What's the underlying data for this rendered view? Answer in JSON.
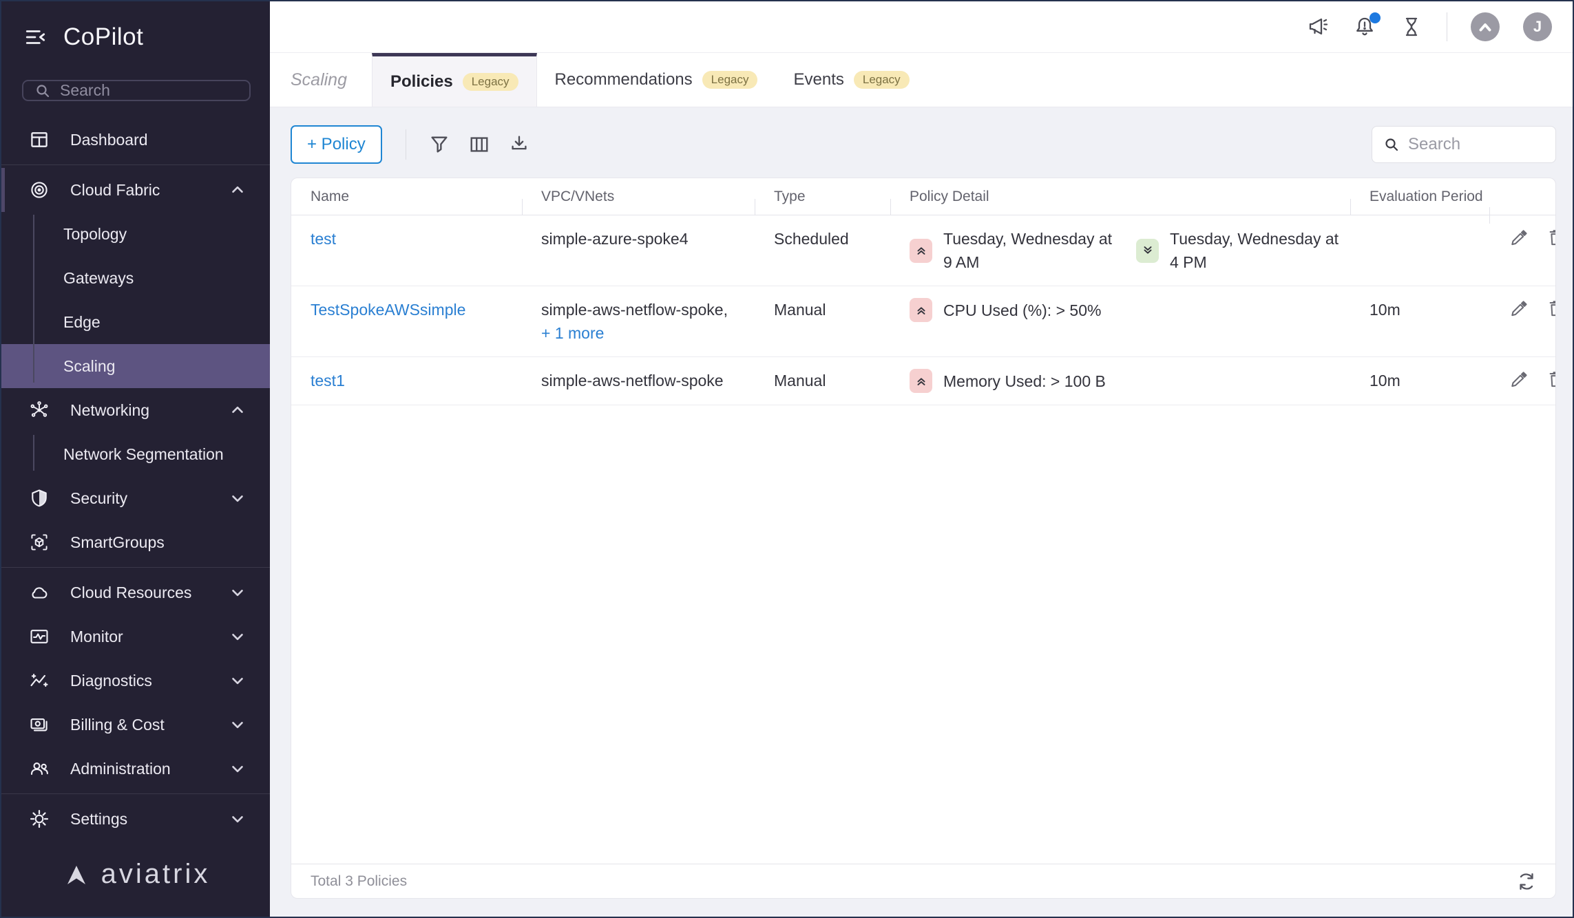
{
  "colors": {
    "sidebar_bg": "#242133",
    "sidebar_selected": "#5d5481",
    "link_blue": "#2a7fd2",
    "primary_blue": "#1f86d3",
    "active_tab_indicator": "#3d3756",
    "legacy_badge_bg": "#f8e9b6",
    "scale_out_badge_bg": "#f6d0d0",
    "scale_in_badge_bg": "#dcecd2",
    "notification_dot": "#1d79e0"
  },
  "sidebar": {
    "brand": "CoPilot",
    "search_placeholder": "Search",
    "items": {
      "dashboard": "Dashboard",
      "cloud_fabric": "Cloud Fabric",
      "topology": "Topology",
      "gateways": "Gateways",
      "edge": "Edge",
      "scaling": "Scaling",
      "networking": "Networking",
      "network_segmentation": "Network Segmentation",
      "security": "Security",
      "smartgroups": "SmartGroups",
      "cloud_resources": "Cloud Resources",
      "monitor": "Monitor",
      "diagnostics": "Diagnostics",
      "billing": "Billing & Cost",
      "administration": "Administration",
      "settings": "Settings"
    },
    "logo_text": "aviatrix"
  },
  "topbar": {
    "icons": [
      "announcements-icon",
      "notifications-icon",
      "tasks-icon"
    ],
    "user_initial": "J"
  },
  "tabs": {
    "page_title": "Scaling",
    "items": [
      {
        "label": "Policies",
        "badge": "Legacy"
      },
      {
        "label": "Recommendations",
        "badge": "Legacy"
      },
      {
        "label": "Events",
        "badge": "Legacy"
      }
    ]
  },
  "toolbar": {
    "add_policy_label": "+ Policy",
    "search_placeholder": "Search"
  },
  "table": {
    "columns": [
      "Name",
      "VPC/VNets",
      "Type",
      "Policy Detail",
      "Evaluation Period"
    ],
    "rows": [
      {
        "name": "test",
        "vpc": "simple-azure-spoke4",
        "type": "Scheduled",
        "details": [
          {
            "direction": "scale-out",
            "text": "Tuesday, Wednesday at 9 AM"
          },
          {
            "direction": "scale-in",
            "text": "Tuesday, Wednesday at 4 PM"
          }
        ],
        "evaluation": ""
      },
      {
        "name": "TestSpokeAWSsimple",
        "vpc": "simple-aws-netflow-spoke,",
        "vpc_more": "+ 1 more",
        "type": "Manual",
        "details": [
          {
            "direction": "scale-out",
            "text": "CPU Used (%): > 50%"
          }
        ],
        "evaluation": "10m"
      },
      {
        "name": "test1",
        "vpc": "simple-aws-netflow-spoke",
        "type": "Manual",
        "details": [
          {
            "direction": "scale-out",
            "text": "Memory Used: > 100 B"
          }
        ],
        "evaluation": "10m"
      }
    ],
    "footer_text": "Total 3 Policies"
  }
}
